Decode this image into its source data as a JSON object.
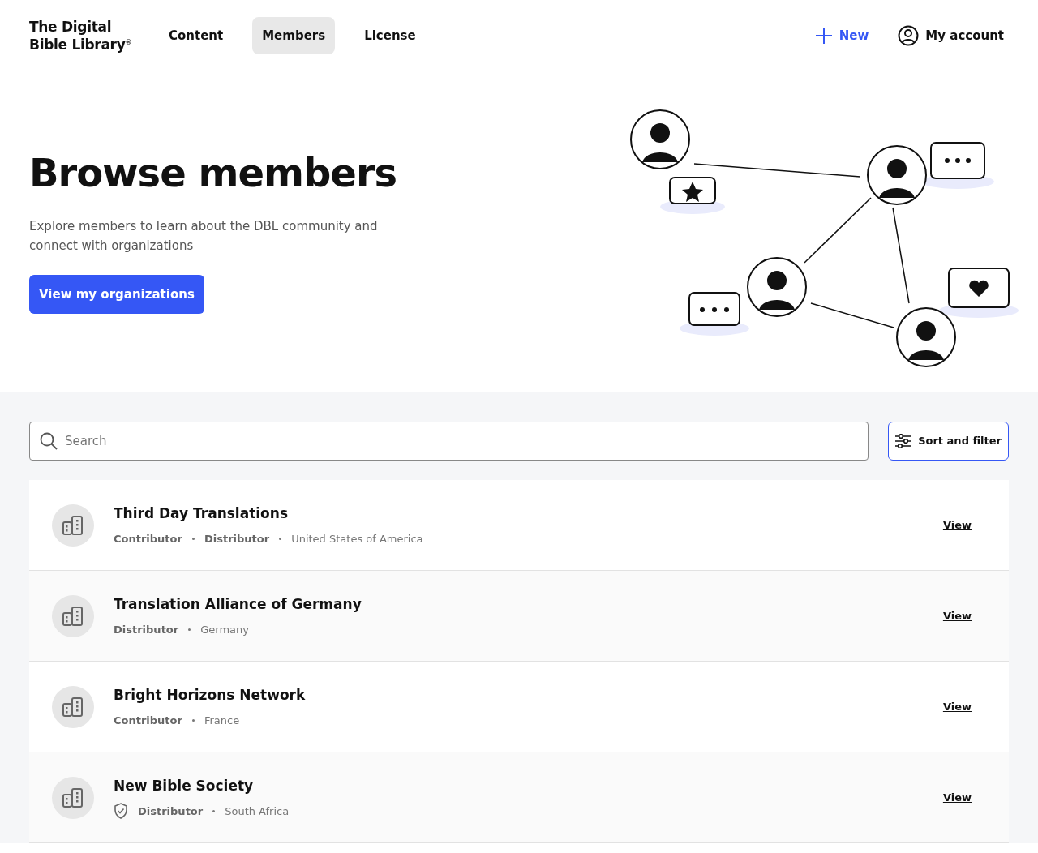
{
  "header": {
    "logo": "The Digital Bible Library$^{®}$",
    "nav": [
      {
        "label": "Content",
        "selected": false
      },
      {
        "label": "Members",
        "selected": true
      },
      {
        "label": "License",
        "selected": false
      }
    ],
    "new_button": "New",
    "account_button": "My account"
  },
  "hero": {
    "title": "Browse members",
    "description": "Explore members to learn about the DBL community and connect with organizations",
    "button": "View my organizations"
  },
  "search": {
    "placeholder": "Search"
  },
  "sort_button": "Sort and filter",
  "members": [
    {
      "name": "Third Day Translations",
      "verified": false,
      "roles": [
        "Contributor",
        "Distributor"
      ],
      "country": "United States of America",
      "action": "View"
    },
    {
      "name": "Translation Alliance of Germany",
      "verified": false,
      "roles": [
        "Distributor"
      ],
      "country": "Germany",
      "action": "View"
    },
    {
      "name": "Bright Horizons Network",
      "verified": false,
      "roles": [
        "Contributor"
      ],
      "country": "France",
      "action": "View"
    },
    {
      "name": "New Bible Society",
      "verified": true,
      "roles": [
        "Distributor"
      ],
      "country": "South Africa",
      "action": "View"
    }
  ]
}
